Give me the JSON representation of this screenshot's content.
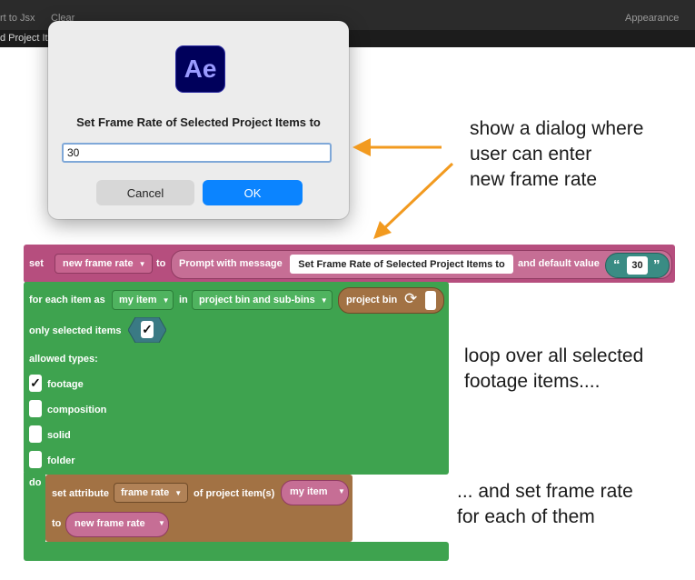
{
  "topbar": {
    "left_items": [
      "rt to Jsx",
      "Clear"
    ],
    "right_item": "Appearance",
    "sub_title": "d Project It"
  },
  "dialog": {
    "app_icon_text": "Ae",
    "app_icon_color": "#00005b",
    "title": "Set Frame Rate of Selected Project Items to",
    "input_value": "30",
    "cancel_label": "Cancel",
    "ok_label": "OK",
    "ok_color": "#0b84ff"
  },
  "annotations": {
    "dialog_note": "show a dialog where\nuser can enter\nnew frame rate",
    "loop_note": "loop over all selected\nfootage items....",
    "set_note": "... and set frame rate\nfor each of them",
    "arrow_color": "#f29a1f"
  },
  "set_block": {
    "set_label": "set",
    "variable": "new frame rate",
    "to_label": "to",
    "prompt_label": "Prompt with message",
    "message": "Set Frame Rate of Selected Project Items to",
    "default_label": "and default value",
    "open_quote": "“",
    "close_quote": "”",
    "default_value": "30",
    "color": "#b64e7e"
  },
  "loop_block": {
    "for_each_label": "for each item as",
    "item_var": "my item",
    "in_label": "in",
    "scope": "project bin and sub-bins",
    "bin_label": "project bin",
    "only_selected_label": "only selected items",
    "allowed_label": "allowed types:",
    "types": [
      {
        "label": "footage",
        "checked": true
      },
      {
        "label": "composition",
        "checked": false
      },
      {
        "label": "solid",
        "checked": false
      },
      {
        "label": "folder",
        "checked": false
      }
    ],
    "do_label": "do",
    "color": "#3ea34f"
  },
  "attr_block": {
    "set_attribute_label": "set attribute",
    "attribute": "frame rate",
    "of_label": "of project item(s)",
    "item_var": "my item",
    "to_label": "to",
    "value_var": "new frame rate",
    "color": "#a27244"
  },
  "check_glyph": "✓",
  "caret_glyph": "▼"
}
